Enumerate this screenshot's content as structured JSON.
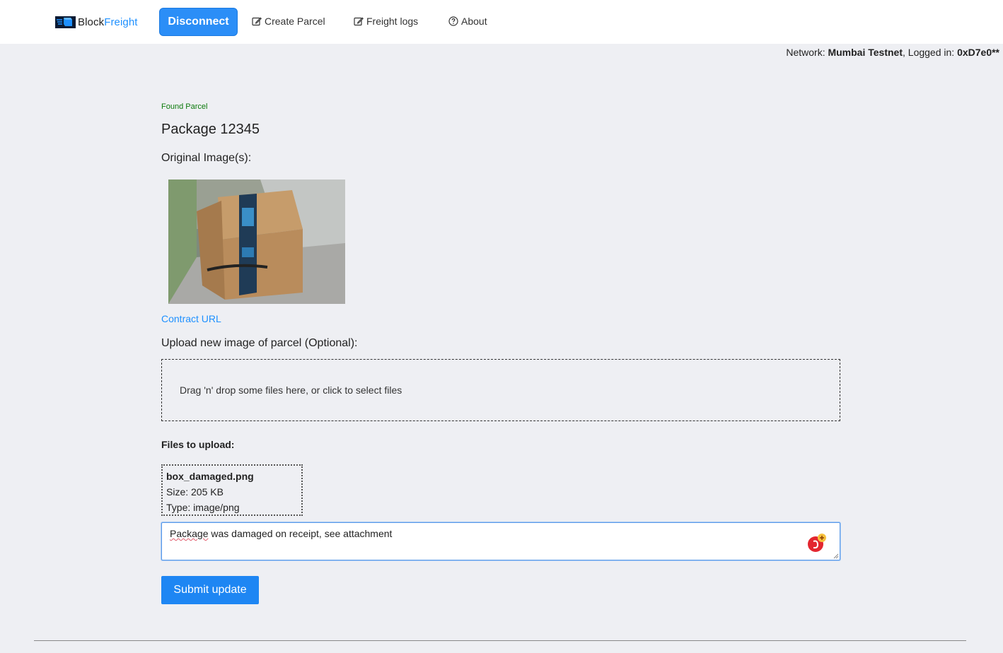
{
  "navbar": {
    "brand_part1": "Block",
    "brand_part2": "Freight",
    "disconnect_label": "Disconnect",
    "links": [
      {
        "label": "Create Parcel",
        "icon": "edit-icon"
      },
      {
        "label": "Freight logs",
        "icon": "edit-icon"
      },
      {
        "label": "About",
        "icon": "question-circle-icon"
      }
    ]
  },
  "status": {
    "network_label": "Network: ",
    "network_value": "Mumbai Testnet",
    "logged_label": ", Logged in: ",
    "logged_value": "0xD7e0**"
  },
  "parcel": {
    "found_label": "Found Parcel",
    "title": "Package 12345",
    "original_images_label": "Original Image(s):",
    "contract_link": "Contract URL"
  },
  "upload": {
    "label": "Upload new image of parcel (Optional):",
    "dropzone_text": "Drag 'n' drop some files here, or click to select files",
    "files_label": "Files to upload:",
    "files": [
      {
        "name": "box_damaged.png",
        "size": "Size: 205 KB",
        "type": "Type: image/png"
      }
    ]
  },
  "note": {
    "value_word1": "Package",
    "value_rest": " was damaged on receipt, see attachment"
  },
  "submit_label": "Submit update",
  "colors": {
    "accent": "#1e86f3",
    "success": "#0b7a0b",
    "background": "#eeeff3"
  }
}
